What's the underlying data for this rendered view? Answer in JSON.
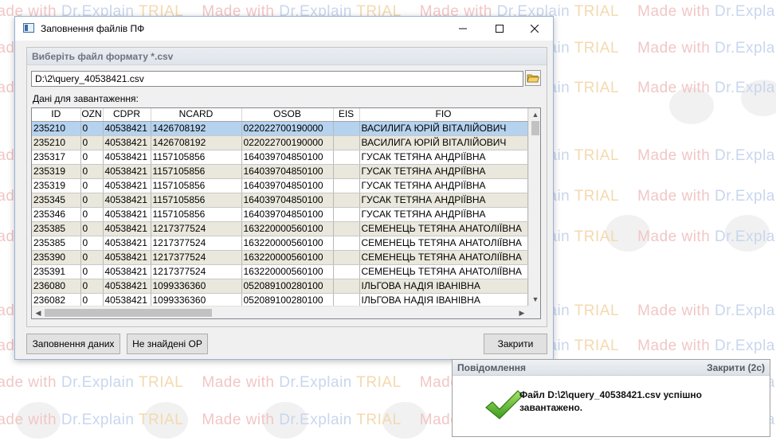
{
  "watermark": {
    "made_with": "Made with ",
    "brand": "Dr.Explain ",
    "trial": "TRIAL"
  },
  "window": {
    "title": "Заповнення файлів ПФ",
    "group_title": "Виберіть файл формату *.csv",
    "file_path": "D:\\2\\query_40538421.csv",
    "data_label": "Дані для завантаження:",
    "columns": [
      "ID",
      "OZN",
      "CDPR",
      "NCARD",
      "OSOB",
      "EIS",
      "FIO"
    ],
    "rows": [
      [
        "235210",
        "0",
        "40538421",
        "1426708192",
        "022022700190000",
        "",
        "ВАСИЛИГА ЮРІЙ ВІТАЛІЙОВИЧ"
      ],
      [
        "235210",
        "0",
        "40538421",
        "1426708192",
        "022022700190000",
        "",
        "ВАСИЛИГА ЮРІЙ ВІТАЛІЙОВИЧ"
      ],
      [
        "235317",
        "0",
        "40538421",
        "1157105856",
        "164039704850100",
        "",
        "ГУСАК ТЕТЯНА АНДРІЇВНА"
      ],
      [
        "235319",
        "0",
        "40538421",
        "1157105856",
        "164039704850100",
        "",
        "ГУСАК ТЕТЯНА АНДРІЇВНА"
      ],
      [
        "235319",
        "0",
        "40538421",
        "1157105856",
        "164039704850100",
        "",
        "ГУСАК ТЕТЯНА АНДРІЇВНА"
      ],
      [
        "235345",
        "0",
        "40538421",
        "1157105856",
        "164039704850100",
        "",
        "ГУСАК ТЕТЯНА АНДРІЇВНА"
      ],
      [
        "235346",
        "0",
        "40538421",
        "1157105856",
        "164039704850100",
        "",
        "ГУСАК ТЕТЯНА АНДРІЇВНА"
      ],
      [
        "235385",
        "0",
        "40538421",
        "1217377524",
        "163220000560100",
        "",
        "СЕМЕНЕЦЬ ТЕТЯНА АНАТОЛІЇВНА"
      ],
      [
        "235385",
        "0",
        "40538421",
        "1217377524",
        "163220000560100",
        "",
        "СЕМЕНЕЦЬ ТЕТЯНА АНАТОЛІЇВНА"
      ],
      [
        "235390",
        "0",
        "40538421",
        "1217377524",
        "163220000560100",
        "",
        "СЕМЕНЕЦЬ ТЕТЯНА АНАТОЛІЇВНА"
      ],
      [
        "235391",
        "0",
        "40538421",
        "1217377524",
        "163220000560100",
        "",
        "СЕМЕНЕЦЬ ТЕТЯНА АНАТОЛІЇВНА"
      ],
      [
        "236080",
        "0",
        "40538421",
        "1099336360",
        "052089100280100",
        "",
        "ІЛЬГОВА НАДІЯ ІВАНІВНА"
      ],
      [
        "236082",
        "0",
        "40538421",
        "1099336360",
        "052089100280100",
        "",
        "ІЛЬГОВА НАДІЯ ІВАНІВНА"
      ]
    ],
    "selected_row": 0,
    "buttons": {
      "fill": "Заповнення даних",
      "not_found": "Не знайдені ОР",
      "close": "Закрити"
    }
  },
  "notification": {
    "title": "Повідомлення",
    "close_label": "Закрити (2c)",
    "message": "Файл D:\\2\\query_40538421.csv успішно завантажено."
  },
  "icons": {
    "app": "form-icon",
    "folder": "folder-open-icon",
    "success": "checkmark-icon"
  }
}
